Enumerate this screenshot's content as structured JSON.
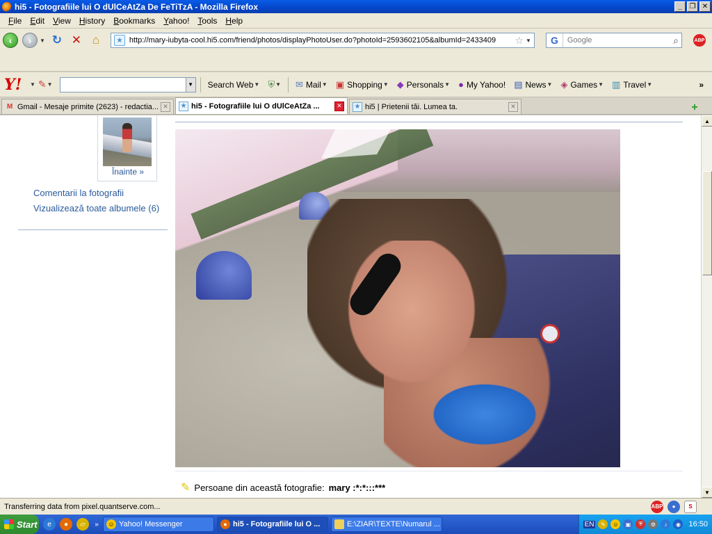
{
  "window": {
    "title": "hi5 - Fotografiile lui O dUlCeAtZa De FeTiTzA - Mozilla Firefox",
    "minimize": "_",
    "restore": "❐",
    "close": "✕"
  },
  "menu": [
    "File",
    "Edit",
    "View",
    "History",
    "Bookmarks",
    "Yahoo!",
    "Tools",
    "Help"
  ],
  "nav": {
    "url": "http://mary-iubyta-cool.hi5.com/friend/photos/displayPhotoUser.do?photoId=2593602105&albumId=2433409",
    "search_placeholder": "Google",
    "abp": "ABP"
  },
  "yahoo_toolbar": {
    "logo": "Y!",
    "search_web": "Search Web",
    "items": [
      {
        "label": "Mail",
        "icon": "envelope-icon"
      },
      {
        "label": "Shopping",
        "icon": "bag-icon"
      },
      {
        "label": "Personals",
        "icon": "heart-icon"
      },
      {
        "label": "My Yahoo!",
        "icon": "my-yahoo-icon"
      },
      {
        "label": "News",
        "icon": "news-icon"
      },
      {
        "label": "Games",
        "icon": "games-icon"
      },
      {
        "label": "Travel",
        "icon": "travel-icon"
      }
    ],
    "more": "»"
  },
  "tabs": [
    {
      "label": "Gmail - Mesaje primite (2623) - redactia...",
      "active": false
    },
    {
      "label": "hi5 - Fotografiile lui O dUlCeAtZa ...",
      "active": true
    },
    {
      "label": "hi5 | Prietenii tăi. Lumea ta.",
      "active": false
    }
  ],
  "sidebar": {
    "next_link": "Înainte »",
    "comments_link": "Comentarii la fotografii",
    "albums_link": "Vizualizează toate albumele (6)"
  },
  "persons": {
    "label": "Persoane din această fotografie:",
    "name": "mary :*:*:::***"
  },
  "status": {
    "text": "Transferring data from pixel.quantserve.com..."
  },
  "taskbar": {
    "start": "Start",
    "more": "»",
    "tasks": [
      {
        "label": "Yahoo! Messenger",
        "active": false
      },
      {
        "label": "hi5 - Fotografiile lui O ...",
        "active": true
      },
      {
        "label": "E:\\ZIAR\\TEXTE\\Numarul ...",
        "active": false
      }
    ],
    "lang": "EN",
    "clock": "16:50"
  }
}
